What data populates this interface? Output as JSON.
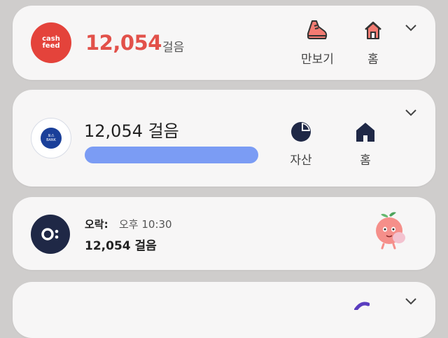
{
  "cards": [
    {
      "app": "cashfeed",
      "logo_text": [
        "cash",
        "feed"
      ],
      "steps": "12,054",
      "unit": "걸음",
      "actions": [
        {
          "label": "만보기",
          "icon": "sneaker-icon"
        },
        {
          "label": "홈",
          "icon": "home-icon"
        }
      ],
      "accent": "#e4433b"
    },
    {
      "app": "bank",
      "logo_text": [
        "토스",
        "BANK"
      ],
      "steps_text": "12,054 걸음",
      "progress": 1.0,
      "actions": [
        {
          "label": "자산",
          "icon": "pie-chart-icon"
        },
        {
          "label": "홈",
          "icon": "home-icon"
        }
      ],
      "accent": "#7b9cf4"
    },
    {
      "app_label": "오락:",
      "time": "오후 10:30",
      "steps_text": "12,054 걸음",
      "mascot": "peach-mascot-icon"
    }
  ]
}
